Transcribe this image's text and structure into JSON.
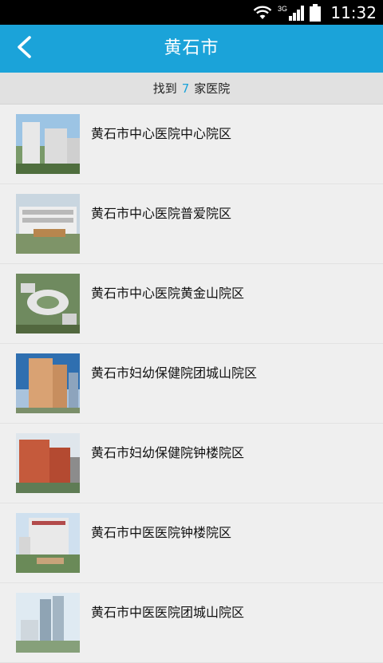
{
  "status_bar": {
    "time": "11:32",
    "network": "3G",
    "icons": [
      "wifi-icon",
      "signal-icon",
      "battery-icon"
    ]
  },
  "header": {
    "title": "黄石市",
    "back_icon": "chevron-left-icon"
  },
  "summary": {
    "prefix": "找到",
    "count": "7",
    "suffix": "家医院"
  },
  "hospitals": [
    {
      "name": "黄石市中心医院中心院区",
      "image": "hospital-photo"
    },
    {
      "name": "黄石市中心医院普爱院区",
      "image": "hospital-photo"
    },
    {
      "name": "黄石市中心医院黄金山院区",
      "image": "hospital-photo"
    },
    {
      "name": "黄石市妇幼保健院团城山院区",
      "image": "hospital-photo"
    },
    {
      "name": "黄石市妇幼保健院钟楼院区",
      "image": "hospital-photo"
    },
    {
      "name": "黄石市中医医院钟楼院区",
      "image": "hospital-photo"
    },
    {
      "name": "黄石市中医医院团城山院区",
      "image": "hospital-photo"
    }
  ],
  "colors": {
    "accent": "#1ba3d9",
    "background": "#efefef",
    "summary_bar": "#e1e1e1"
  }
}
